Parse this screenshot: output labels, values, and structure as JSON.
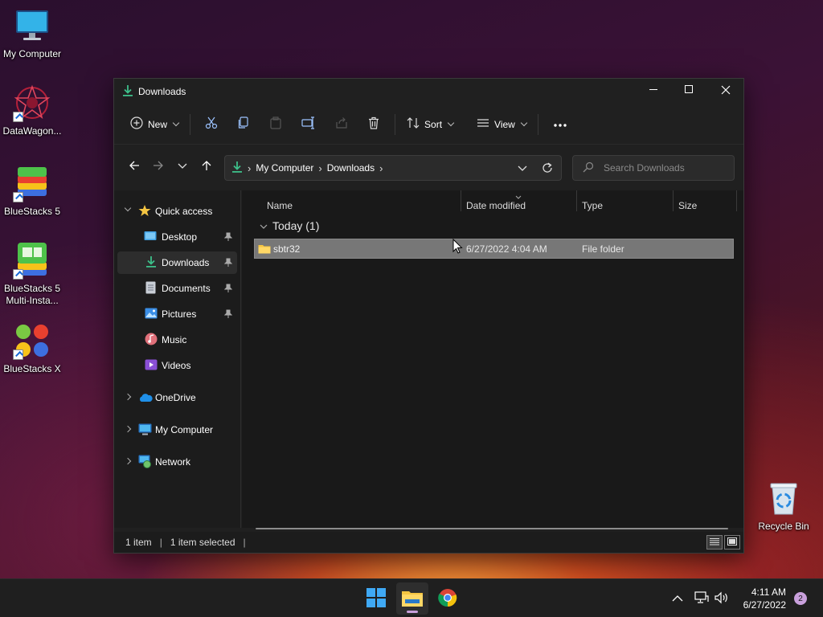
{
  "desktop": {
    "icons": [
      {
        "label": "My Computer"
      },
      {
        "label": "DataWagon..."
      },
      {
        "label": "BlueStacks 5"
      },
      {
        "label": "BlueStacks 5 Multi-Insta..."
      },
      {
        "label": "BlueStacks X"
      },
      {
        "label": "Recycle Bin"
      }
    ]
  },
  "window": {
    "title": "Downloads",
    "controls": [
      "minimize-icon",
      "maximize-icon",
      "close-icon"
    ]
  },
  "toolbar": {
    "new_label": "New",
    "sort_label": "Sort",
    "view_label": "View",
    "icons": [
      "cut-icon",
      "copy-icon",
      "paste-icon",
      "rename-icon",
      "share-icon",
      "delete-icon",
      "more-icon"
    ]
  },
  "address": {
    "crumbs": [
      "My Computer",
      "Downloads"
    ]
  },
  "search": {
    "placeholder": "Search Downloads"
  },
  "nav": {
    "quick_access": "Quick access",
    "items": [
      {
        "label": "Desktop",
        "pinned": true
      },
      {
        "label": "Downloads",
        "pinned": true,
        "selected": true
      },
      {
        "label": "Documents",
        "pinned": true
      },
      {
        "label": "Pictures",
        "pinned": true
      },
      {
        "label": "Music",
        "pinned": false
      },
      {
        "label": "Videos",
        "pinned": false
      }
    ],
    "roots": [
      {
        "label": "OneDrive"
      },
      {
        "label": "My Computer"
      },
      {
        "label": "Network"
      }
    ]
  },
  "list": {
    "columns": [
      "Name",
      "Date modified",
      "Type",
      "Size"
    ],
    "group_label": "Today (1)",
    "rows": [
      {
        "name": "sbtr32",
        "date": "6/27/2022 4:04 AM",
        "type": "File folder",
        "size": ""
      }
    ]
  },
  "status": {
    "count": "1 item",
    "selected": "1 item selected"
  },
  "taskbar": {
    "apps": [
      "windows-start-icon",
      "file-explorer-icon",
      "chrome-icon"
    ],
    "time": "4:11 AM",
    "date": "6/27/2022",
    "notifications": "2"
  },
  "colors": {
    "accent": "#3a8ee6",
    "folder": "#f5c542",
    "download_green": "#3dbf8a",
    "selection": "#777777"
  }
}
